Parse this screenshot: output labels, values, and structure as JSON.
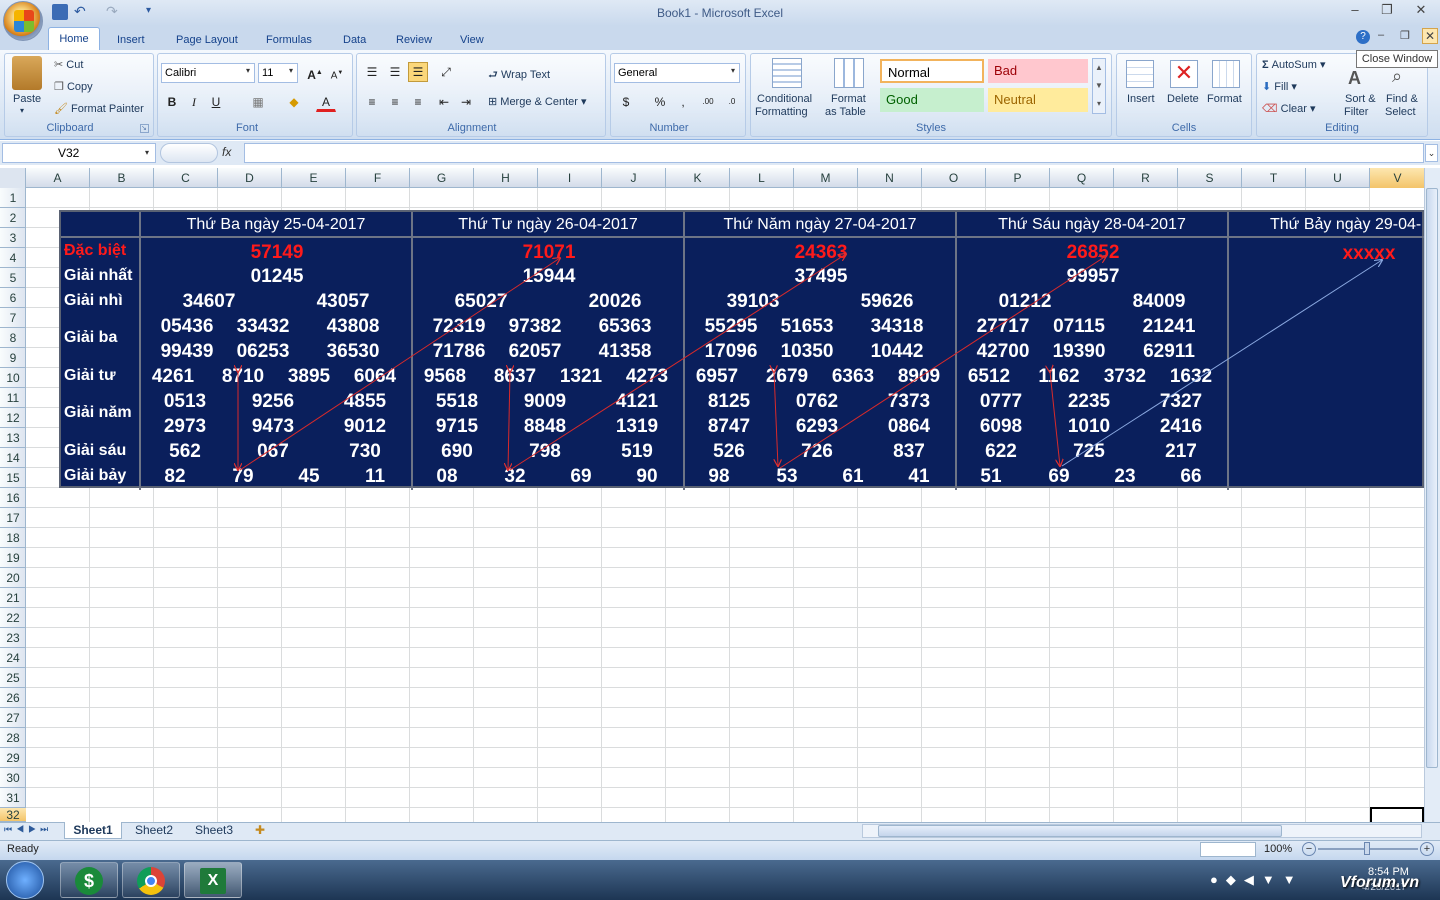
{
  "window": {
    "title": "Book1 - Microsoft Excel",
    "tooltip": "Close Window"
  },
  "ribbon": {
    "tabs": [
      "Home",
      "Insert",
      "Page Layout",
      "Formulas",
      "Data",
      "Review",
      "View"
    ],
    "clipboard": {
      "paste": "Paste",
      "cut": "Cut",
      "copy": "Copy",
      "format_painter": "Format Painter",
      "label": "Clipboard"
    },
    "font": {
      "name": "Calibri",
      "size": "11",
      "label": "Font",
      "bold": "B",
      "italic": "I",
      "underline": "U"
    },
    "alignment": {
      "wrap": "Wrap Text",
      "merge": "Merge & Center",
      "label": "Alignment"
    },
    "number": {
      "format": "General",
      "currency": "$",
      "percent": "%",
      "comma": ",",
      "label": "Number"
    },
    "styles": {
      "conditional": "Conditional",
      "conditional2": "Formatting",
      "format_table": "Format",
      "format_table2": "as Table",
      "normal": "Normal",
      "bad": "Bad",
      "good": "Good",
      "neutral": "Neutral",
      "label": "Styles"
    },
    "cells": {
      "insert": "Insert",
      "delete": "Delete",
      "format": "Format",
      "label": "Cells"
    },
    "editing": {
      "autosum": "AutoSum",
      "fill": "Fill",
      "clear": "Clear",
      "sort": "Sort &",
      "sort2": "Filter",
      "find": "Find &",
      "find2": "Select",
      "label": "Editing"
    }
  },
  "formula_bar": {
    "name_box": "V32",
    "fx": "fx",
    "value": ""
  },
  "columns": [
    "A",
    "B",
    "C",
    "D",
    "E",
    "F",
    "G",
    "H",
    "I",
    "J",
    "K",
    "L",
    "M",
    "N",
    "O",
    "P",
    "Q",
    "R",
    "S",
    "T",
    "U",
    "V"
  ],
  "rows": [
    "1",
    "2",
    "3",
    "4",
    "5",
    "6",
    "7",
    "8",
    "9",
    "10",
    "11",
    "12",
    "13",
    "14",
    "15",
    "16",
    "17",
    "18",
    "19",
    "20",
    "21",
    "22",
    "23",
    "24",
    "25",
    "26",
    "27",
    "28",
    "29",
    "30",
    "31",
    "32"
  ],
  "lottery": {
    "labels": {
      "special": "Đặc biệt",
      "first": "Giải nhất",
      "second": "Giải nhì",
      "third": "Giải ba",
      "fourth": "Giải tư",
      "fifth": "Giải năm",
      "sixth": "Giải sáu",
      "seventh": "Giải bảy"
    },
    "days": [
      {
        "header": "Thứ Ba ngày 25-04-2017",
        "special": "57149",
        "first": "01245",
        "second": [
          "34607",
          "43057"
        ],
        "third": [
          "05436",
          "33432",
          "43808",
          "99439",
          "06253",
          "36530"
        ],
        "fourth": [
          "4261",
          "8710",
          "3895",
          "6064"
        ],
        "fifth": [
          "0513",
          "9256",
          "4855",
          "2973",
          "9473",
          "9012"
        ],
        "sixth": [
          "562",
          "067",
          "730"
        ],
        "seventh": [
          "82",
          "79",
          "45",
          "11"
        ]
      },
      {
        "header": "Thứ Tư ngày 26-04-2017",
        "special": "71071",
        "first": "15944",
        "second": [
          "65027",
          "20026"
        ],
        "third": [
          "72319",
          "97382",
          "65363",
          "71786",
          "62057",
          "41358"
        ],
        "fourth": [
          "9568",
          "8637",
          "1321",
          "4273"
        ],
        "fifth": [
          "5518",
          "9009",
          "4121",
          "9715",
          "8848",
          "1319"
        ],
        "sixth": [
          "690",
          "798",
          "519"
        ],
        "seventh": [
          "08",
          "32",
          "69",
          "90"
        ]
      },
      {
        "header": "Thứ Năm ngày 27-04-2017",
        "special": "24363",
        "first": "37495",
        "second": [
          "39103",
          "59626"
        ],
        "third": [
          "55295",
          "51653",
          "34318",
          "17096",
          "10350",
          "10442"
        ],
        "fourth": [
          "6957",
          "2679",
          "6363",
          "8909"
        ],
        "fifth": [
          "8125",
          "0762",
          "7373",
          "8747",
          "6293",
          "0864"
        ],
        "sixth": [
          "526",
          "726",
          "837"
        ],
        "seventh": [
          "98",
          "53",
          "61",
          "41"
        ]
      },
      {
        "header": "Thứ Sáu ngày 28-04-2017",
        "special": "26852",
        "first": "99957",
        "second": [
          "01212",
          "84009"
        ],
        "third": [
          "27717",
          "07115",
          "21241",
          "42700",
          "19390",
          "62911"
        ],
        "fourth": [
          "6512",
          "1162",
          "3732",
          "1632"
        ],
        "fifth": [
          "0777",
          "2235",
          "7327",
          "6098",
          "1010",
          "2416"
        ],
        "sixth": [
          "622",
          "725",
          "217"
        ],
        "seventh": [
          "51",
          "69",
          "23",
          "66"
        ]
      },
      {
        "header": "Thứ Bảy ngày 29-04-",
        "special": "xxxxx"
      }
    ]
  },
  "sheets": [
    "Sheet1",
    "Sheet2",
    "Sheet3"
  ],
  "status": {
    "ready": "Ready",
    "zoom": "100%"
  },
  "taskbar": {
    "time": "8:54 PM",
    "date": "4/28/2017",
    "watermark": "Vforum.vn"
  },
  "colors": {
    "table_bg": "#0a1f5c",
    "special": "#ff1a1a",
    "ribbon": "#dae6f4"
  }
}
